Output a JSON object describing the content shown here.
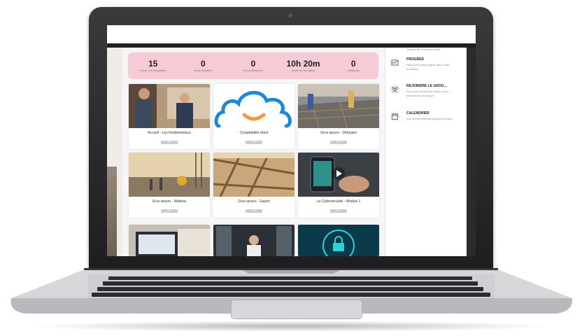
{
  "stats": [
    {
      "value": "15",
      "label": "cours non complétés"
    },
    {
      "value": "0",
      "label": "cours terminés"
    },
    {
      "value": "0",
      "label": "cours démarrés"
    },
    {
      "value": "10h 20m",
      "label": "durée de formation"
    },
    {
      "value": "0",
      "label": "certificats"
    }
  ],
  "courses": [
    {
      "title": "Accueil - Les fondamentaux",
      "progress": 0,
      "progress_label": "0%"
    },
    {
      "title": "Comptabilité client",
      "progress": 0,
      "progress_label": "0%"
    },
    {
      "title": "Gros œuvre - Débutant",
      "progress": 0,
      "progress_label": "0%"
    },
    {
      "title": "Gros œuvre - Maîtrise",
      "progress": 0,
      "progress_label": "0%"
    },
    {
      "title": "Gros œuvre - Expert",
      "progress": 0,
      "progress_label": "0%"
    },
    {
      "title": "La Cybersécurité - Module 1",
      "progress": 0,
      "progress_label": "0%"
    }
  ],
  "sidebar": {
    "top_desc": "Trouver de nouveaux cours",
    "items": [
      {
        "title": "PROGRÈS",
        "desc": "Découvrir votre progrès dans votre formation",
        "icon": "progress-chart-icon"
      },
      {
        "title": "REJOINDRE LE GROU...",
        "desc": "Pour avoir accès aux cours et aux discussions de groupe",
        "icon": "group-icon"
      },
      {
        "title": "CALENDRIER",
        "desc": "Voir les événements actuels et futurs",
        "icon": "calendar-icon"
      }
    ]
  },
  "colors": {
    "stats_bg": "#f7cbd6",
    "progress_fill": "#4fae63",
    "cloud_blue": "#1e88d8",
    "cloud_smile": "#f39c3d"
  }
}
